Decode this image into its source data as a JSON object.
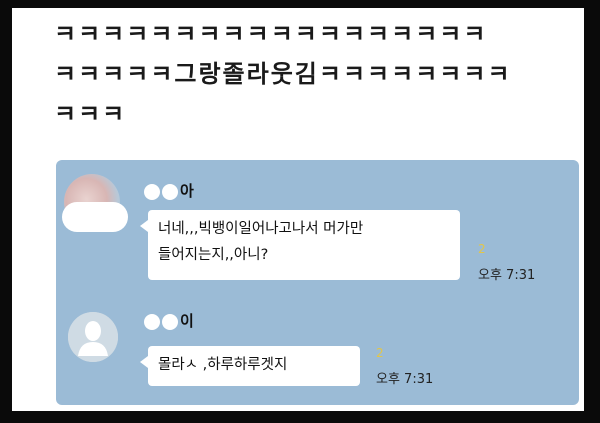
{
  "post": {
    "lines": [
      "ㅋㅋㅋㅋㅋㅋㅋㅋㅋㅋㅋㅋㅋㅋㅋㅋㅋㅋ",
      "ㅋㅋㅋㅋㅋ그랑졸라웃김ㅋㅋㅋㅋㅋㅋㅋㅋ",
      "ㅋㅋㅋ"
    ]
  },
  "chat": {
    "messages": [
      {
        "sender": "아",
        "lines": [
          "너네,,,빅뱅이일어나고나서 머가만",
          "들어지는지,,아니?"
        ],
        "unread": "2",
        "time": "오후 7:31"
      },
      {
        "sender": "이",
        "lines": [
          "몰라ㅅ  ,하루하루겟지"
        ],
        "unread": "2",
        "time": "오후 7:31"
      }
    ]
  }
}
